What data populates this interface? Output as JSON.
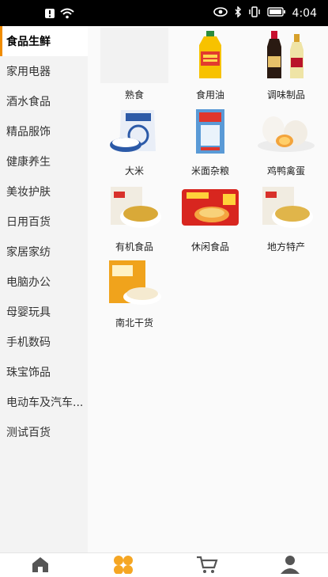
{
  "status": {
    "time": "4:04"
  },
  "sidebar": {
    "items": [
      {
        "label": "食品生鲜",
        "active": true
      },
      {
        "label": "家用电器"
      },
      {
        "label": "酒水食品"
      },
      {
        "label": "精品服饰"
      },
      {
        "label": "健康养生"
      },
      {
        "label": "美妆护肤"
      },
      {
        "label": "日用百货"
      },
      {
        "label": "家居家纺"
      },
      {
        "label": "电脑办公"
      },
      {
        "label": "母婴玩具"
      },
      {
        "label": "手机数码"
      },
      {
        "label": "珠宝饰品"
      },
      {
        "label": "电动车及汽车..."
      },
      {
        "label": "测试百货"
      }
    ]
  },
  "categories": [
    {
      "label": "熟食",
      "icon": "blank-image"
    },
    {
      "label": "食用油",
      "icon": "oil-bottle-icon"
    },
    {
      "label": "调味制品",
      "icon": "sauce-bottles-icon"
    },
    {
      "label": "大米",
      "icon": "rice-bag-icon"
    },
    {
      "label": "米面杂粮",
      "icon": "flour-bag-icon"
    },
    {
      "label": "鸡鸭禽蛋",
      "icon": "eggs-icon"
    },
    {
      "label": "有机食品",
      "icon": "grain-bowl-icon"
    },
    {
      "label": "休闲食品",
      "icon": "noodle-pack-icon"
    },
    {
      "label": "地方特产",
      "icon": "grain-bowl-icon"
    },
    {
      "label": "南北干货",
      "icon": "dried-goods-icon"
    }
  ],
  "tabbar": {
    "tabs": [
      {
        "icon": "home-icon"
      },
      {
        "icon": "category-icon",
        "active": true
      },
      {
        "icon": "cart-icon"
      },
      {
        "icon": "user-icon"
      }
    ],
    "active_color": "#f5a623",
    "inactive_color": "#555555"
  }
}
